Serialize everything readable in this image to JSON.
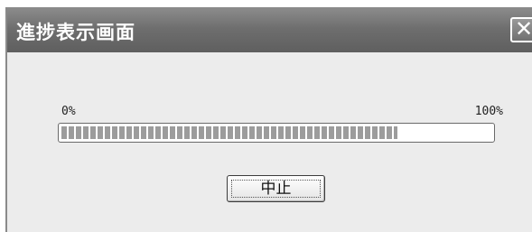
{
  "window": {
    "title": "進捗表示画面",
    "close_glyph": "✕"
  },
  "progress": {
    "min_label": "0%",
    "max_label": "100%",
    "value_percent": 78
  },
  "buttons": {
    "abort_label": "中止"
  },
  "colors": {
    "titlebar": "#6e6e6e",
    "dialog_background": "#ececec",
    "progress_fill": "#9c9c9c"
  }
}
